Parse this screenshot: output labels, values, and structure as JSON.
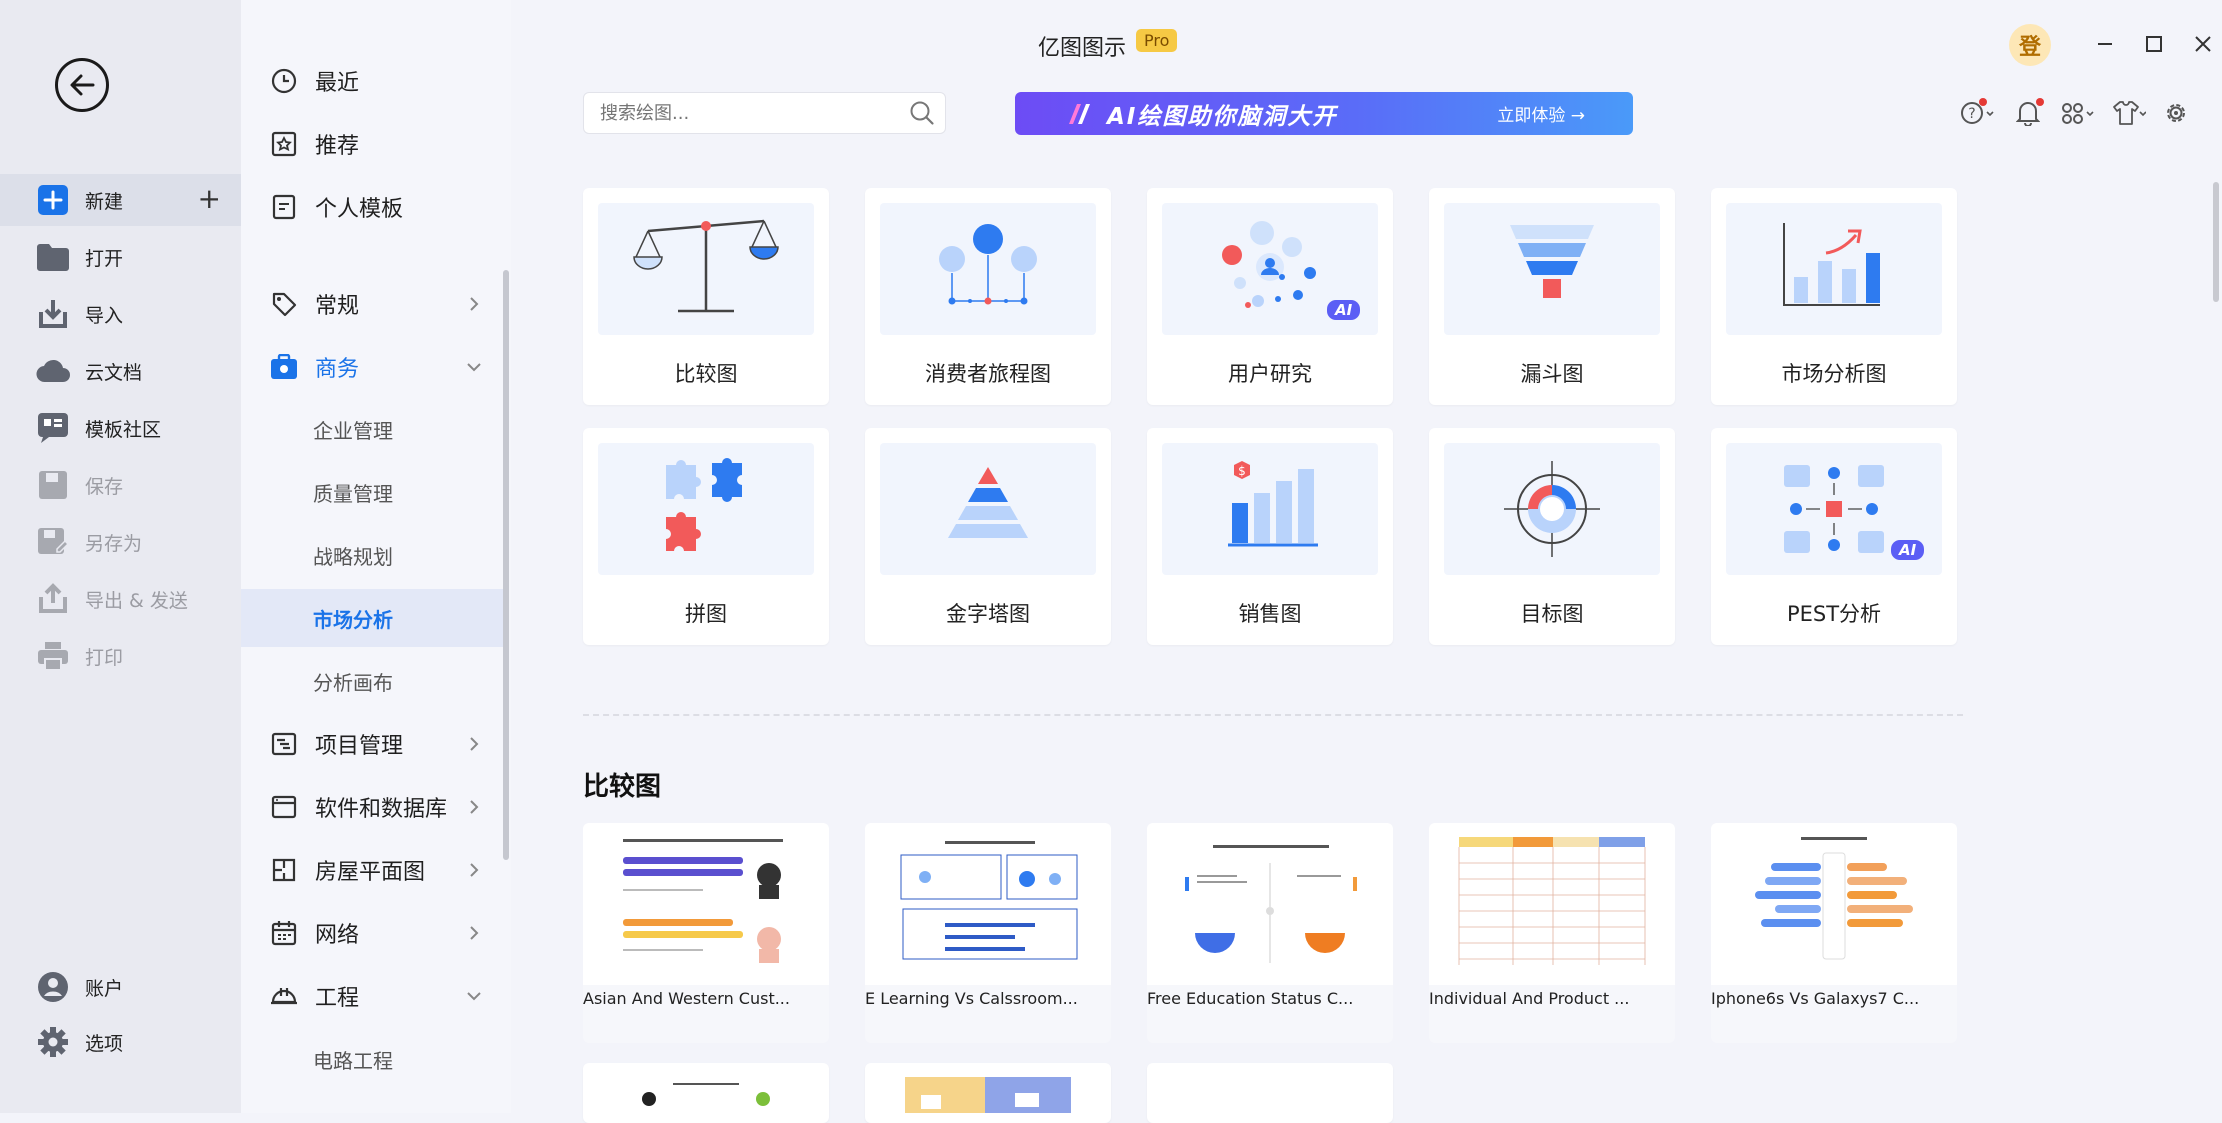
{
  "app": {
    "title": "亿图图示",
    "badge": "Pro",
    "avatar_text": "登"
  },
  "rail": {
    "items": [
      {
        "label": "新建",
        "icon": "new-file-icon",
        "state": "active"
      },
      {
        "label": "打开",
        "icon": "folder-icon",
        "state": "normal"
      },
      {
        "label": "导入",
        "icon": "import-icon",
        "state": "normal"
      },
      {
        "label": "云文档",
        "icon": "cloud-icon",
        "state": "normal"
      },
      {
        "label": "模板社区",
        "icon": "community-icon",
        "state": "normal"
      },
      {
        "label": "保存",
        "icon": "save-icon",
        "state": "disabled"
      },
      {
        "label": "另存为",
        "icon": "save-as-icon",
        "state": "disabled"
      },
      {
        "label": "导出 & 发送",
        "icon": "export-icon",
        "state": "disabled"
      },
      {
        "label": "打印",
        "icon": "print-icon",
        "state": "disabled"
      }
    ],
    "bottom": [
      {
        "label": "账户",
        "icon": "account-icon"
      },
      {
        "label": "选项",
        "icon": "settings-icon"
      }
    ]
  },
  "categories": {
    "top": [
      {
        "label": "最近",
        "icon": "clock-icon"
      },
      {
        "label": "推荐",
        "icon": "recommend-icon"
      },
      {
        "label": "个人模板",
        "icon": "personal-template-icon"
      }
    ],
    "groups": [
      {
        "label": "常规",
        "icon": "tag-icon",
        "expanded": false
      },
      {
        "label": "商务",
        "icon": "business-icon",
        "expanded": true,
        "subs": [
          "企业管理",
          "质量管理",
          "战略规划",
          "市场分析",
          "分析画布"
        ],
        "selected": "市场分析"
      },
      {
        "label": "项目管理",
        "icon": "gantt-icon",
        "expanded": false
      },
      {
        "label": "软件和数据库",
        "icon": "software-icon",
        "expanded": false
      },
      {
        "label": "房屋平面图",
        "icon": "floorplan-icon",
        "expanded": false
      },
      {
        "label": "网络",
        "icon": "network-icon",
        "expanded": false
      },
      {
        "label": "工程",
        "icon": "helmet-icon",
        "expanded": true,
        "subs": [
          "电路工程"
        ]
      }
    ]
  },
  "search": {
    "placeholder": "搜索绘图..."
  },
  "banner": {
    "text": "AI绘图助你脑洞大开",
    "cta": "立即体验"
  },
  "diagram_types": [
    {
      "label": "比较图",
      "ai": false
    },
    {
      "label": "消费者旅程图",
      "ai": false
    },
    {
      "label": "用户研究",
      "ai": true
    },
    {
      "label": "漏斗图",
      "ai": false
    },
    {
      "label": "市场分析图",
      "ai": false
    },
    {
      "label": "拼图",
      "ai": false
    },
    {
      "label": "金字塔图",
      "ai": false
    },
    {
      "label": "销售图",
      "ai": false
    },
    {
      "label": "目标图",
      "ai": false
    },
    {
      "label": "PEST分析",
      "ai": true
    }
  ],
  "ai_tag": "AI",
  "section": {
    "title": "比较图"
  },
  "templates": [
    {
      "title": "Asian And Western Cust..."
    },
    {
      "title": "E Learning Vs Calssroom..."
    },
    {
      "title": "Free Education Status C..."
    },
    {
      "title": "Individual And Product ..."
    },
    {
      "title": "Iphone6s Vs Galaxys7 C..."
    }
  ],
  "colors": {
    "accent": "#1a73e8",
    "banner_start": "#6d4cf5",
    "banner_end": "#4a9af9",
    "pro": "#f6c944"
  }
}
